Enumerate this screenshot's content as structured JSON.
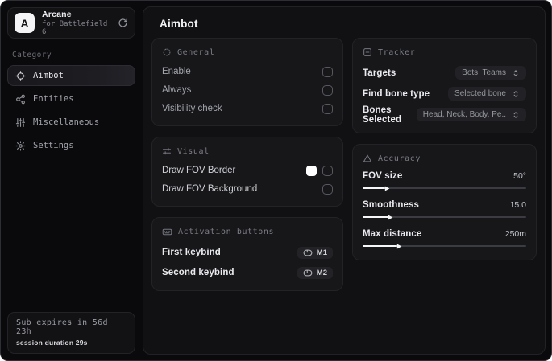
{
  "colors": {
    "window_bg": "#0a0a0c",
    "panel_bg": "#111114",
    "card_bg": "#17171a",
    "border": "#232327",
    "text_primary": "#eaebef",
    "text_muted": "#7b7e85",
    "accent_swatch": "#ffffff"
  },
  "sidebar": {
    "header": {
      "logo_letter": "A",
      "name": "Arcane",
      "subtitle": "for Battlefield 6",
      "action_icon": "refresh-icon"
    },
    "category_label": "Category",
    "items": [
      {
        "label": "Aimbot",
        "icon": "crosshair-icon",
        "active": true
      },
      {
        "label": "Entities",
        "icon": "entities-icon",
        "active": false
      },
      {
        "label": "Miscellaneous",
        "icon": "sliders-vertical-icon",
        "active": false
      },
      {
        "label": "Settings",
        "icon": "gear-icon",
        "active": false
      }
    ],
    "footer": {
      "line1": "Sub expires in 56d 23h",
      "line2": "session duration 29s"
    }
  },
  "main": {
    "title": "Aimbot",
    "general": {
      "title": "General",
      "icon": "crosshair-dotted-icon",
      "rows": [
        {
          "label": "Enable",
          "checked": false
        },
        {
          "label": "Always",
          "checked": false
        },
        {
          "label": "Visibility check",
          "checked": false
        }
      ]
    },
    "visual": {
      "title": "Visual",
      "icon": "sliders-horizontal-icon",
      "rows": [
        {
          "label": "Draw FOV Border",
          "swatch": "#ffffff",
          "checked": false
        },
        {
          "label": "Draw FOV Background",
          "checked": false
        }
      ]
    },
    "activation": {
      "title": "Activation buttons",
      "icon": "keyboard-icon",
      "rows": [
        {
          "label": "First keybind",
          "key": "M1"
        },
        {
          "label": "Second keybind",
          "key": "M2"
        }
      ]
    },
    "tracker": {
      "title": "Tracker",
      "icon": "scan-minus-icon",
      "rows": [
        {
          "label": "Targets",
          "value": "Bots, Teams"
        },
        {
          "label": "Find bone type",
          "value": "Selected bone"
        },
        {
          "label": "Bones Selected",
          "value": "Head, Neck, Body, Pe.."
        }
      ]
    },
    "accuracy": {
      "title": "Accuracy",
      "icon": "triangle-icon",
      "sliders": [
        {
          "label": "FOV size",
          "value": "50°",
          "fill_percent": 14
        },
        {
          "label": "Smoothness",
          "value": "15.0",
          "fill_percent": 16
        },
        {
          "label": "Max distance",
          "value": "250m",
          "fill_percent": 21
        }
      ]
    }
  }
}
